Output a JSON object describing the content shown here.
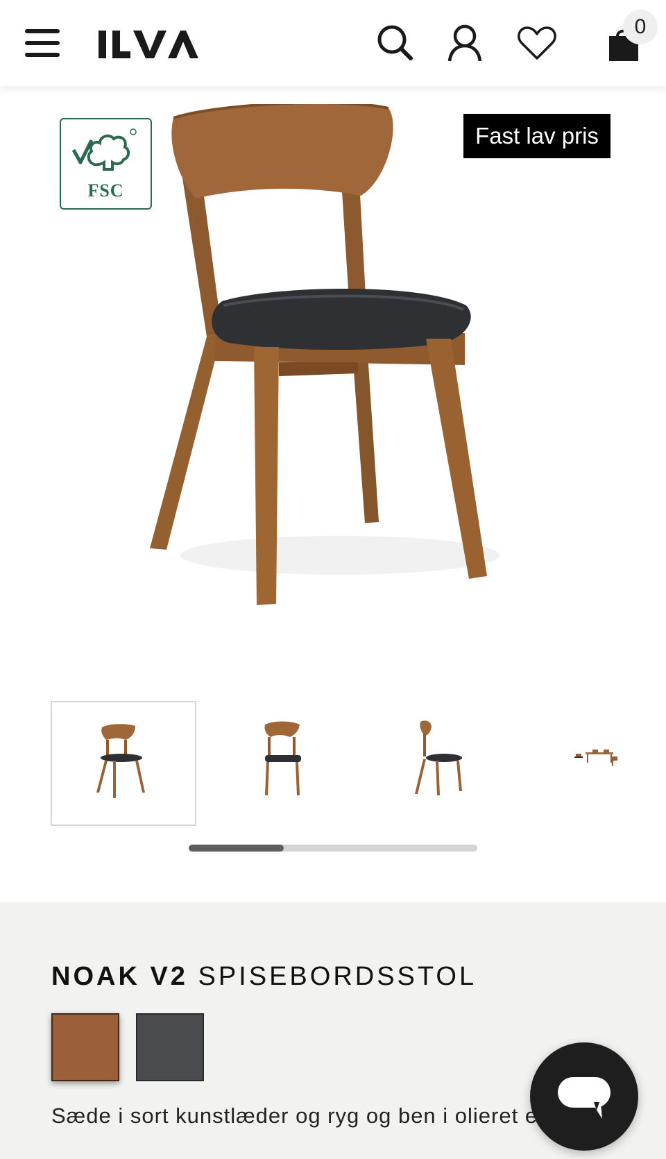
{
  "header": {
    "logo_text": "ILVA",
    "cart_count": "0",
    "icons": [
      "menu-icon",
      "search-icon",
      "account-icon",
      "heart-icon",
      "shopping-bag-icon"
    ]
  },
  "hero": {
    "certification_label": "FSC",
    "price_badge": "Fast lav pris"
  },
  "gallery": {
    "thumbnails": [
      "chair-angled-view",
      "chair-front-view",
      "chair-side-view",
      "dining-room-scene"
    ],
    "active_index": 0,
    "scroll_fraction": 0.33
  },
  "product": {
    "name": "NOAK V2",
    "type": "SPISEBORDSSTOL",
    "swatches": [
      {
        "name": "oak",
        "color": "#9b5f3a"
      },
      {
        "name": "grey",
        "color": "#4a4b4f"
      }
    ],
    "description": "Sæde i sort kunstlæder og ryg og ben i olieret eg"
  },
  "colors": {
    "fsc_green": "#2c6a4e",
    "badge_black": "#000000",
    "info_background": "#f2f2f0"
  }
}
